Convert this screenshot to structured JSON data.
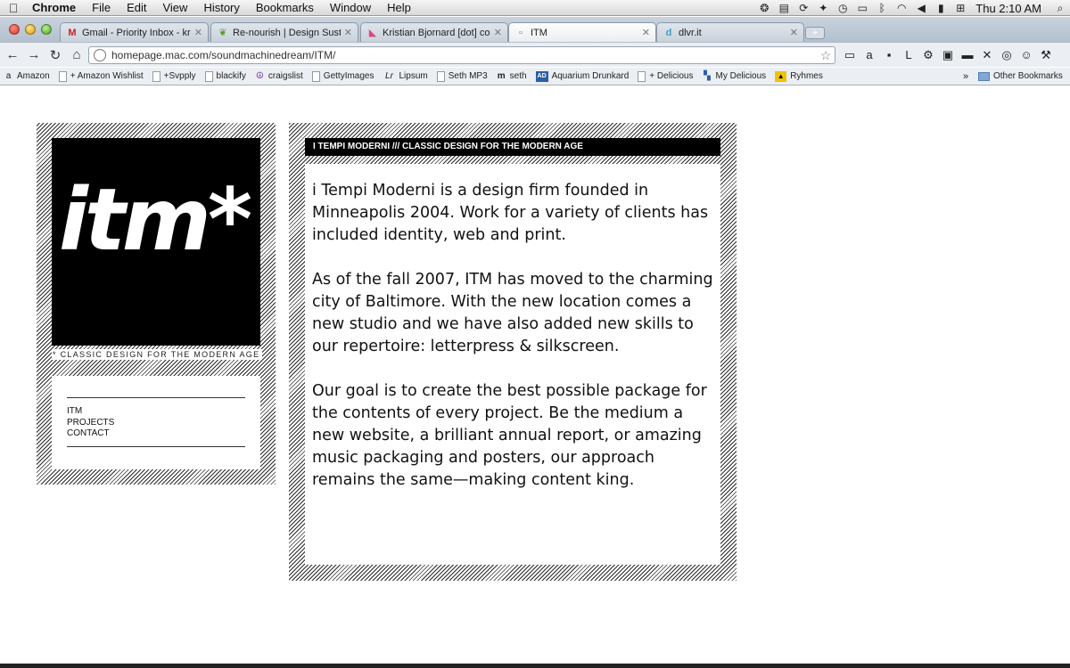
{
  "menubar": {
    "app": "Chrome",
    "items": [
      "File",
      "Edit",
      "View",
      "History",
      "Bookmarks",
      "Window",
      "Help"
    ],
    "clock": "Thu 2:10 AM"
  },
  "tabs": [
    {
      "label": "Gmail - Priority Inbox - krist",
      "favicon": "gmail-icon",
      "favicon_glyph": "M"
    },
    {
      "label": "Re-nourish | Design Sustain",
      "favicon": "leaf-icon",
      "favicon_glyph": "❦"
    },
    {
      "label": "Kristian Bjornard [dot] com |",
      "favicon": "kb-icon",
      "favicon_glyph": "◣"
    },
    {
      "label": "ITM",
      "favicon": "page-icon",
      "favicon_glyph": "▫"
    },
    {
      "label": "dlvr.it",
      "favicon": "dlvr-icon",
      "favicon_glyph": "d"
    }
  ],
  "active_tab_index": 3,
  "toolbar": {
    "url": "homepage.mac.com/soundmachinedream/ITM/"
  },
  "bookmarks": {
    "items": [
      {
        "label": "Amazon",
        "icon": "amazon-icon",
        "glyph": "a"
      },
      {
        "label": "+ Amazon Wishlist",
        "icon": "page-icon",
        "glyph": ""
      },
      {
        "label": "+Svpply",
        "icon": "page-icon",
        "glyph": ""
      },
      {
        "label": "blackify",
        "icon": "page-icon",
        "glyph": ""
      },
      {
        "label": "craigslist",
        "icon": "peace-icon",
        "glyph": "☮"
      },
      {
        "label": "GettyImages",
        "icon": "page-icon",
        "glyph": ""
      },
      {
        "label": "Lipsum",
        "icon": "lipsum-icon",
        "glyph": "Lr"
      },
      {
        "label": "Seth MP3",
        "icon": "page-icon",
        "glyph": ""
      },
      {
        "label": "seth",
        "icon": "m-icon",
        "glyph": "m"
      },
      {
        "label": "Aquarium Drunkard",
        "icon": "ad-icon",
        "glyph": "AD"
      },
      {
        "label": "+ Delicious",
        "icon": "page-icon",
        "glyph": ""
      },
      {
        "label": "My Delicious",
        "icon": "delicious-icon",
        "glyph": "▚"
      },
      {
        "label": "Ryhmes",
        "icon": "rhymes-icon",
        "glyph": "▲"
      }
    ],
    "more": "»",
    "other": "Other Bookmarks"
  },
  "page": {
    "logo": "itm*",
    "tagline": "* CLASSIC DESIGN FOR THE MODERN AGE",
    "nav": [
      "ITM",
      "PROJECTS",
      "CONTACT"
    ],
    "header": "I TEMPI MODERNI /// CLASSIC DESIGN FOR THE MODERN AGE",
    "paragraphs": [
      "i Tempi Moderni is a design firm founded in Minneapolis 2004. Work for a variety of clients has included identity, web and print.",
      "As of the fall 2007, ITM has moved to the charming city of Baltimore. With the new location comes a new studio and we have also added new skills to our repertoire: letterpress & silkscreen.",
      "Our goal is to create the best possible package for the contents of every project. Be the medium a new website, a brilliant annual report, or amazing music packaging and posters, our approach remains the same—making content king."
    ]
  }
}
